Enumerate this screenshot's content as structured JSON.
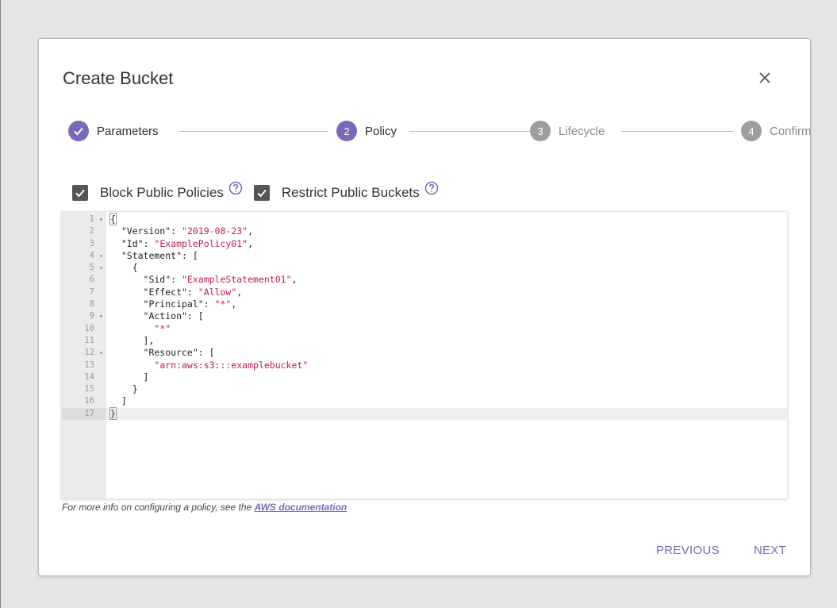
{
  "dialog": {
    "title": "Create Bucket",
    "close_icon": "close-icon"
  },
  "stepper": {
    "steps": [
      {
        "number": "",
        "label": "Parameters",
        "state": "completed"
      },
      {
        "number": "2",
        "label": "Policy",
        "state": "active"
      },
      {
        "number": "3",
        "label": "Lifecycle",
        "state": "inactive"
      },
      {
        "number": "4",
        "label": "Confirm",
        "state": "inactive"
      }
    ]
  },
  "options": {
    "block_public_policies": {
      "label": "Block Public Policies",
      "checked": true
    },
    "restrict_public_buckets": {
      "label": "Restrict Public Buckets",
      "checked": true
    }
  },
  "editor": {
    "lines": [
      {
        "n": "1",
        "fold": true,
        "text": "{"
      },
      {
        "n": "2",
        "fold": false,
        "text": "  \"Version\": \"2019-08-23\","
      },
      {
        "n": "3",
        "fold": false,
        "text": "  \"Id\": \"ExamplePolicy01\","
      },
      {
        "n": "4",
        "fold": true,
        "text": "  \"Statement\": ["
      },
      {
        "n": "5",
        "fold": true,
        "text": "    {"
      },
      {
        "n": "6",
        "fold": false,
        "text": "      \"Sid\": \"ExampleStatement01\","
      },
      {
        "n": "7",
        "fold": false,
        "text": "      \"Effect\": \"Allow\","
      },
      {
        "n": "8",
        "fold": false,
        "text": "      \"Principal\": \"*\","
      },
      {
        "n": "9",
        "fold": true,
        "text": "      \"Action\": ["
      },
      {
        "n": "10",
        "fold": false,
        "text": "        \"*\""
      },
      {
        "n": "11",
        "fold": false,
        "text": "      ],"
      },
      {
        "n": "12",
        "fold": true,
        "text": "      \"Resource\": ["
      },
      {
        "n": "13",
        "fold": false,
        "text": "        \"arn:aws:s3:::examplebucket\""
      },
      {
        "n": "14",
        "fold": false,
        "text": "      ]"
      },
      {
        "n": "15",
        "fold": false,
        "text": "    }"
      },
      {
        "n": "16",
        "fold": false,
        "text": "  ]"
      },
      {
        "n": "17",
        "fold": false,
        "text": "}"
      }
    ],
    "active_line": 17
  },
  "footnote": {
    "text": "For more info on configuring a policy, see the ",
    "link": "AWS documentation"
  },
  "buttons": {
    "previous": "PREVIOUS",
    "next": "NEXT"
  },
  "colors": {
    "accent": "#7b68b8",
    "inactive_step": "#9e9e9e",
    "string": "#c41a5a"
  }
}
